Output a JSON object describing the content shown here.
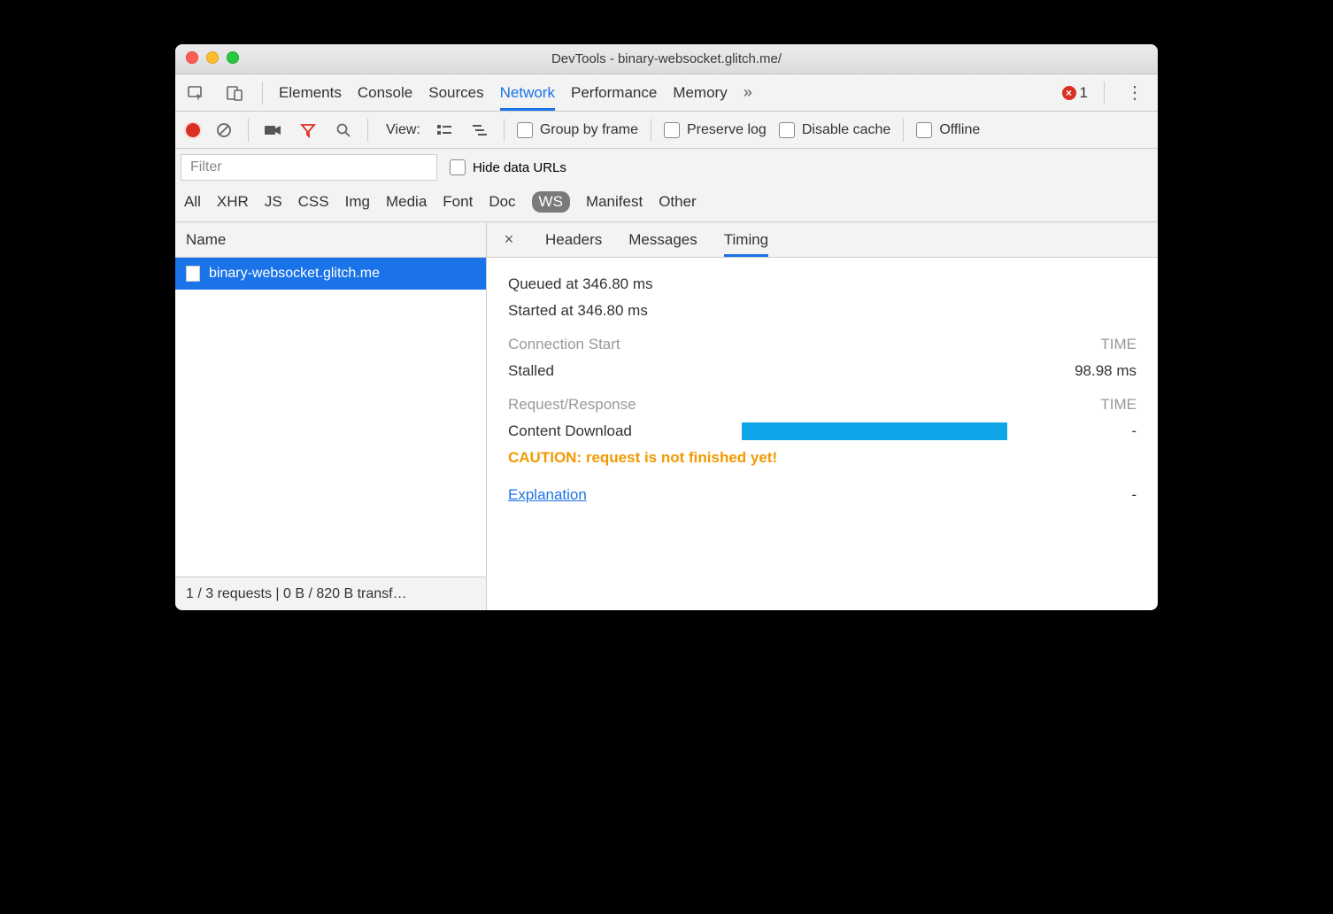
{
  "window": {
    "title": "DevTools - binary-websocket.glitch.me/"
  },
  "tabs": {
    "items": [
      "Elements",
      "Console",
      "Sources",
      "Network",
      "Performance",
      "Memory"
    ],
    "active": "Network",
    "more": "»",
    "errorCount": "1"
  },
  "toolbar": {
    "viewLabel": "View:",
    "groupByFrame": "Group by frame",
    "preserveLog": "Preserve log",
    "disableCache": "Disable cache",
    "offline": "Offline"
  },
  "filter": {
    "placeholder": "Filter",
    "hideDataURLs": "Hide data URLs",
    "types": [
      "All",
      "XHR",
      "JS",
      "CSS",
      "Img",
      "Media",
      "Font",
      "Doc",
      "WS",
      "Manifest",
      "Other"
    ],
    "active": "WS"
  },
  "sidebar": {
    "header": "Name",
    "items": [
      {
        "name": "binary-websocket.glitch.me"
      }
    ],
    "footer": "1 / 3 requests | 0 B / 820 B transf…"
  },
  "detail": {
    "tabs": [
      "Headers",
      "Messages",
      "Timing"
    ],
    "active": "Timing"
  },
  "timing": {
    "queued": "Queued at 346.80 ms",
    "started": "Started at 346.80 ms",
    "connSection": "Connection Start",
    "timeHeader": "TIME",
    "stalledLabel": "Stalled",
    "stalledValue": "98.98 ms",
    "reqSection": "Request/Response",
    "contentLabel": "Content Download",
    "contentValue": "-",
    "caution": "CAUTION: request is not finished yet!",
    "explanation": "Explanation",
    "explanationValue": "-"
  }
}
